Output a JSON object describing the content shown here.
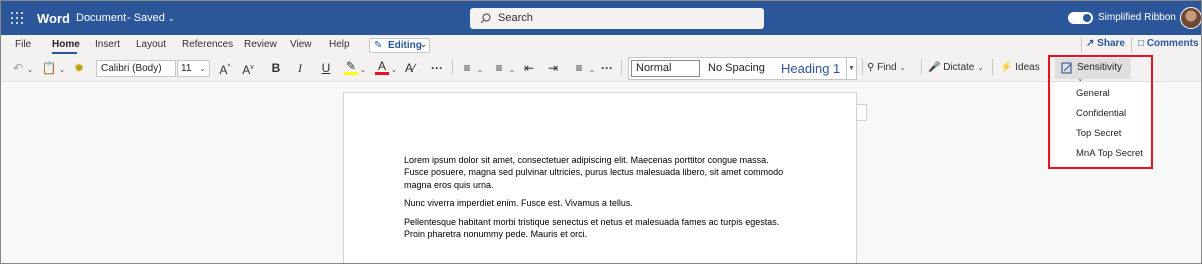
{
  "titlebar": {
    "app_name": "Word",
    "doc_name": "Document",
    "doc_status": "- Saved",
    "search_placeholder": "Search",
    "simplified_ribbon_label": "Simplified Ribbon",
    "simplified_ribbon_on": true,
    "brand_color": "#2b579a"
  },
  "tabs": {
    "items": [
      {
        "label": "File"
      },
      {
        "label": "Home",
        "active": true
      },
      {
        "label": "Insert"
      },
      {
        "label": "Layout"
      },
      {
        "label": "References"
      },
      {
        "label": "Review"
      },
      {
        "label": "View"
      },
      {
        "label": "Help"
      }
    ],
    "editing_label": "Editing",
    "share_label": "Share",
    "comments_label": "Comments"
  },
  "toolbar": {
    "font_name": "Calibri (Body)",
    "font_size": "11",
    "styles": {
      "normal": "Normal",
      "no_spacing": "No Spacing",
      "heading1": "Heading 1"
    },
    "find_label": "Find",
    "dictate_label": "Dictate",
    "ideas_label": "Ideas",
    "sensitivity_label": "Sensitivity"
  },
  "sensitivity_menu": {
    "items": [
      {
        "label": "General"
      },
      {
        "label": "Confidential"
      },
      {
        "label": "Top Secret"
      },
      {
        "label": "MnA Top Secret"
      }
    ],
    "highlight_color": "#e81123"
  },
  "document": {
    "paragraphs": [
      "Lorem ipsum dolor sit amet, consectetuer adipiscing elit. Maecenas porttitor congue massa. Fusce posuere, magna sed pulvinar ultricies, purus lectus malesuada libero, sit amet commodo magna eros quis urna.",
      "Nunc viverra imperdiet enim. Fusce est. Vivamus a tellus.",
      "Pellentesque habitant morbi tristique senectus et netus et malesuada fames ac turpis egestas. Proin pharetra nonummy pede. Mauris et orci."
    ]
  }
}
